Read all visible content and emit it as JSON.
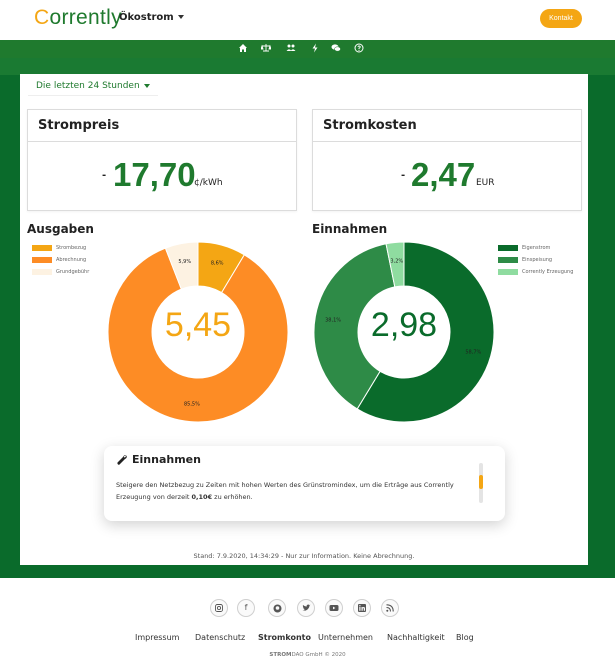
{
  "header": {
    "logo_first": "C",
    "logo_rest": "orrently",
    "brand_menu": "Ökostrom",
    "contact_button": "Kontakt"
  },
  "nav": {
    "icons": [
      "home-icon",
      "balance-scale-icon",
      "users-icon",
      "bolt-icon",
      "comments-icon",
      "question-circle-icon"
    ]
  },
  "period_selector": "Die letzten 24 Stunden",
  "strompreis": {
    "title": "Strompreis",
    "trend": "-",
    "value": "17,70",
    "unit": "¢/kWh"
  },
  "stromkosten": {
    "title": "Stromkosten",
    "trend": "-",
    "value": "2,47",
    "unit": "EUR"
  },
  "colors": {
    "brand_green": "#1f7a2e",
    "dark_green": "#0a6b2b",
    "accent_orange": "#f4a614"
  },
  "chart_data": [
    {
      "type": "pie",
      "title": "Ausgaben",
      "center_label": "5,45",
      "categories": [
        "Strombezug",
        "Abrechnung",
        "Grundgebühr"
      ],
      "values": [
        8.6,
        85.5,
        5.9
      ],
      "labels": [
        "8,6%",
        "85,5%",
        "5,9%"
      ],
      "colors": [
        "#f4a614",
        "#fd8c25",
        "#fdf2e2"
      ],
      "legend": "left"
    },
    {
      "type": "pie",
      "title": "Einnahmen",
      "center_label": "2,98",
      "categories": [
        "Eigenstrom",
        "Einspeisung",
        "Corrently Erzeugung"
      ],
      "values": [
        58.7,
        38.1,
        3.2
      ],
      "labels": [
        "58,7%",
        "38,1%",
        "3,2%"
      ],
      "colors": [
        "#0a6b2b",
        "#2e8b47",
        "#8fdca0"
      ],
      "legend": "right"
    }
  ],
  "info_card": {
    "title": "Einnahmen",
    "text_before": "Steigere den Netzbezug zu Zeiten mit hohen Werten des Grünstromindex, um die Erträge aus Corrently Erzeugung von derzeit",
    "highlight": "0,10€",
    "text_after": "zu erhöhen."
  },
  "stand": "Stand: 7.9.2020, 14:34:29 - Nur zur Information. Keine Abrechnung.",
  "footer": {
    "socials": [
      "instagram-icon",
      "facebook-icon",
      "github-icon",
      "twitter-icon",
      "youtube-icon",
      "linkedin-icon",
      "rss-icon"
    ],
    "links": [
      "Impressum",
      "Datenschutz",
      "Stromkonto",
      "Unternehmen",
      "Nachhaltigkeit",
      "Blog"
    ],
    "copyright_brand": "STROM",
    "copyright_rest": "DAO GmbH © 2020"
  }
}
